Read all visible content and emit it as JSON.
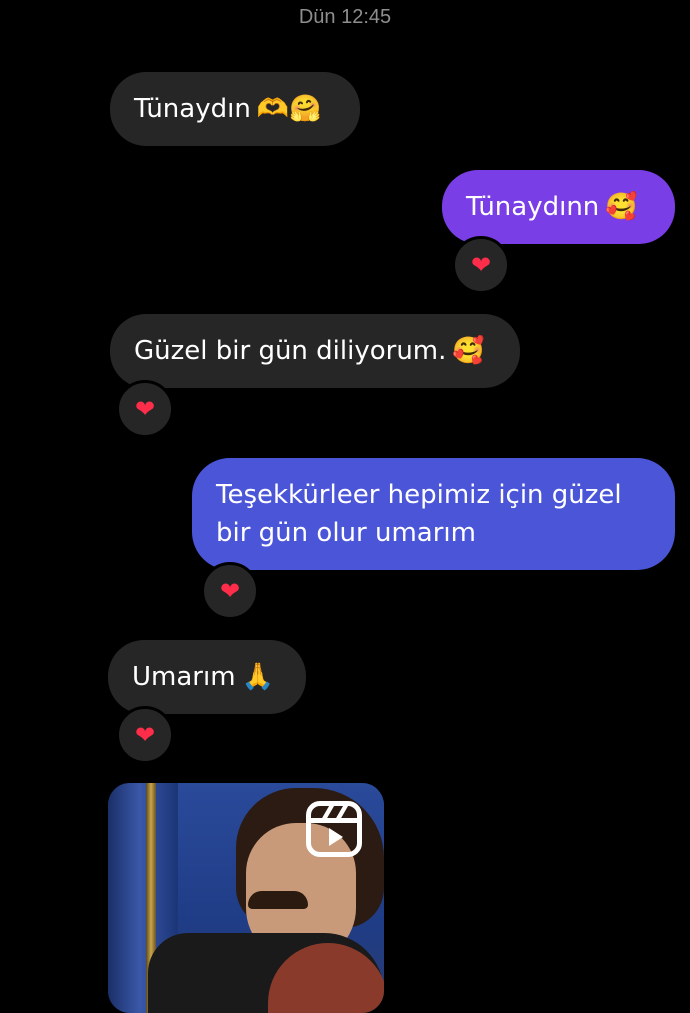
{
  "timestamp": "Dün 12:45",
  "messages": [
    {
      "direction": "incoming",
      "text": "Tünaydın",
      "emoji": "🫶🤗",
      "reaction": "❤"
    },
    {
      "direction": "outgoing",
      "text": "Tünaydınn",
      "emoji": "🥰",
      "reaction": "❤"
    },
    {
      "direction": "incoming",
      "text": "Güzel bir gün diliyorum.",
      "emoji": "🥰",
      "reaction": "❤"
    },
    {
      "direction": "outgoing",
      "text": "Teşekkürleer hepimiz için güzel bir gün olur umarım",
      "emoji": "",
      "reaction": "❤"
    },
    {
      "direction": "incoming",
      "text": "Umarım",
      "emoji": "🙏",
      "reaction": "❤"
    }
  ],
  "reel": {
    "icon": "reels-icon"
  },
  "colors": {
    "background": "#000000",
    "incoming_bubble": "#262626",
    "outgoing_top": "#7a3ee6",
    "outgoing_bottom": "#4b55d8",
    "reaction_heart": "#ff2d4a"
  }
}
